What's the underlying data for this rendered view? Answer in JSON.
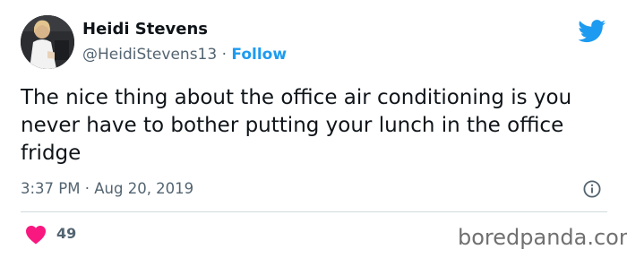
{
  "author": {
    "name": "Heidi Stevens",
    "handle": "@HeidiStevens13",
    "separator": "·",
    "follow_label": "Follow"
  },
  "tweet": {
    "text": "The nice thing about the office air conditioning is you never have to bother putting your lunch in the office fridge",
    "time": "3:37 PM",
    "date_separator": "·",
    "date": "Aug 20, 2019"
  },
  "engagement": {
    "likes": "49"
  },
  "icons": {
    "bird": "twitter-bird-icon",
    "info": "info-icon",
    "heart": "heart-icon"
  },
  "colors": {
    "accent": "#1d9bf0",
    "heart": "#f91880",
    "secondary_text": "#536471"
  },
  "watermark": "boredpanda.com"
}
